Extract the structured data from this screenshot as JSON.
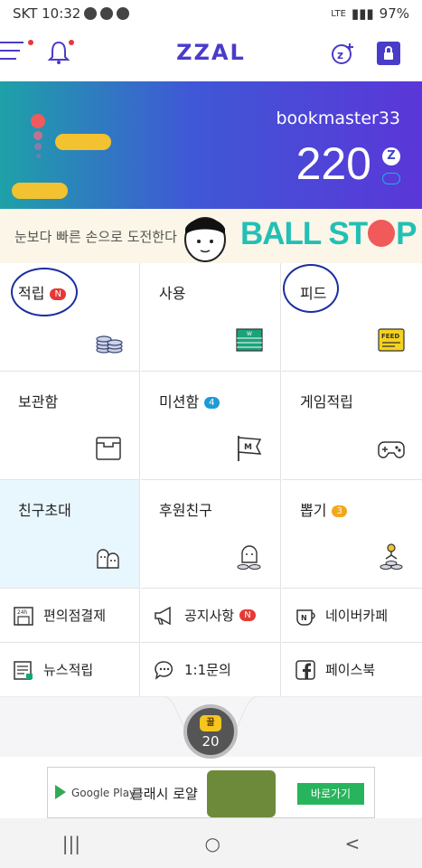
{
  "status": {
    "carrier_time": "SKT 10:32",
    "battery": "97%",
    "signal_text": "LTE"
  },
  "header": {
    "logo": "ZZAL",
    "menu_icon": "hamburger-menu-icon",
    "bell_icon": "bell-icon",
    "coin_icon": "zcoin-add-icon",
    "lock_icon": "lock-icon"
  },
  "banner": {
    "username": "bookmaster33",
    "points": "220",
    "coin_symbol": "Z"
  },
  "game_banner": {
    "tagline": "눈보다 빠른 손으로 도전한다",
    "title_part1": "BALL ST",
    "title_part2": "P"
  },
  "grid": [
    {
      "label": "적립",
      "badge": "N",
      "badge_color": "#e53935",
      "icon": "coin-stack-icon"
    },
    {
      "label": "사용",
      "badge": "",
      "icon": "gift-card-icon"
    },
    {
      "label": "피드",
      "badge": "",
      "icon": "feed-icon"
    },
    {
      "label": "보관함",
      "badge": "",
      "icon": "storage-box-icon"
    },
    {
      "label": "미션함",
      "badge": "4",
      "badge_color": "#1e9ad6",
      "icon": "mission-flag-icon"
    },
    {
      "label": "게임적립",
      "badge": "",
      "icon": "gamepad-icon"
    },
    {
      "label": "친구초대",
      "badge": "",
      "icon": "friends-ghost-icon"
    },
    {
      "label": "후원친구",
      "badge": "",
      "icon": "sponsor-ghost-icon"
    },
    {
      "label": "뽑기",
      "badge": "3",
      "badge_color": "#f2a81d",
      "icon": "claw-machine-icon"
    }
  ],
  "shortcuts": [
    {
      "label": "편의점결제",
      "badge": "",
      "icon": "convenience-store-icon"
    },
    {
      "label": "공지사항",
      "badge": "N",
      "icon": "megaphone-icon"
    },
    {
      "label": "네이버카페",
      "badge": "",
      "icon": "naver-cafe-icon"
    },
    {
      "label": "뉴스적립",
      "badge": "",
      "icon": "news-icon"
    },
    {
      "label": "1:1문의",
      "badge": "",
      "icon": "chat-bubble-icon"
    },
    {
      "label": "페이스북",
      "badge": "",
      "icon": "facebook-icon"
    }
  ],
  "honey": {
    "jar_label": "꿀",
    "count": "20"
  },
  "ad": {
    "store": "Google Play",
    "game_name": "클래시 로얄",
    "cta": "바로가기"
  },
  "navbar": {
    "recent": "|||",
    "home": "○",
    "back": "<"
  }
}
